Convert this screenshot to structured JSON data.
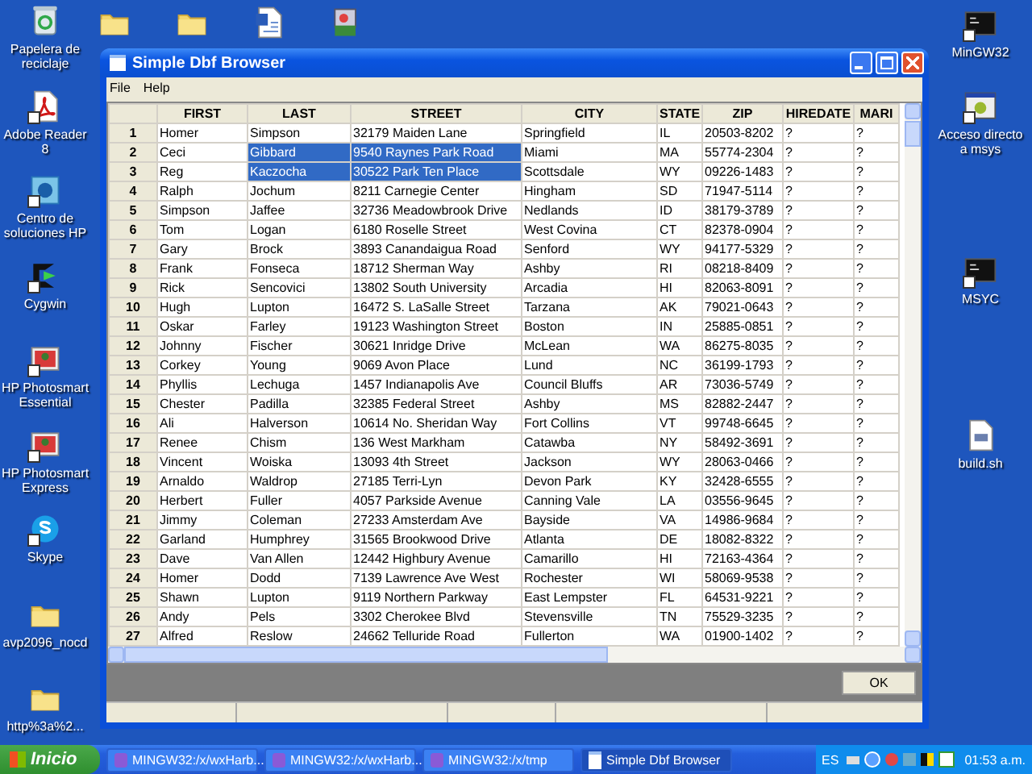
{
  "desktop": {
    "left_icons": [
      {
        "label": "Papelera de reciclaje",
        "kind": "recycle",
        "shortcut": false
      },
      {
        "label": "Adobe Reader 8",
        "kind": "pdf",
        "shortcut": true
      },
      {
        "label": "Centro de soluciones HP",
        "kind": "hp",
        "shortcut": true
      },
      {
        "label": "Cygwin",
        "kind": "cygwin",
        "shortcut": true
      },
      {
        "label": "HP Photosmart Essential",
        "kind": "photo",
        "shortcut": true
      },
      {
        "label": "HP Photosmart Express",
        "kind": "photo",
        "shortcut": true
      },
      {
        "label": "Skype",
        "kind": "skype",
        "shortcut": true
      },
      {
        "label": "avp2096_nocd",
        "kind": "folder",
        "shortcut": false
      },
      {
        "label": "http%3a%2...",
        "kind": "folder",
        "shortcut": false
      }
    ],
    "top_icons": [
      {
        "kind": "folder"
      },
      {
        "kind": "folder"
      },
      {
        "kind": "word"
      },
      {
        "kind": "installer"
      }
    ],
    "right_icons": [
      {
        "label": "MinGW32",
        "kind": "console",
        "shortcut": true
      },
      {
        "label": "Acceso directo a msys",
        "kind": "msys",
        "shortcut": true
      },
      {
        "label": "MSYC",
        "kind": "console",
        "shortcut": true
      },
      {
        "label": "build.sh",
        "kind": "file",
        "shortcut": false
      }
    ]
  },
  "window": {
    "title": "Simple Dbf Browser",
    "menu": [
      "File",
      "Help"
    ],
    "table": {
      "columns": [
        "FIRST",
        "LAST",
        "STREET",
        "CITY",
        "STATE",
        "ZIP",
        "HIREDATE",
        "MARI"
      ],
      "rows": [
        {
          "number": "1",
          "cells": [
            {
              "text": "Homer",
              "selected": false
            },
            {
              "text": "Simpson",
              "selected": false
            },
            {
              "text": "32179 Maiden Lane",
              "selected": false
            },
            {
              "text": "Springfield",
              "selected": false
            },
            {
              "text": "IL",
              "selected": false
            },
            {
              "text": "20503-8202",
              "selected": false
            },
            {
              "text": "?",
              "selected": false
            },
            {
              "text": "?",
              "selected": false
            }
          ]
        },
        {
          "number": "2",
          "cells": [
            {
              "text": "Ceci",
              "selected": false
            },
            {
              "text": "Gibbard",
              "selected": true
            },
            {
              "text": "9540 Raynes Park Road",
              "selected": true
            },
            {
              "text": "Miami",
              "selected": false
            },
            {
              "text": "MA",
              "selected": false
            },
            {
              "text": "55774-2304",
              "selected": false
            },
            {
              "text": "?",
              "selected": false
            },
            {
              "text": "?",
              "selected": false
            }
          ]
        },
        {
          "number": "3",
          "cells": [
            {
              "text": "Reg",
              "selected": false
            },
            {
              "text": "Kaczocha",
              "selected": true
            },
            {
              "text": "30522 Park Ten Place",
              "selected": true
            },
            {
              "text": "Scottsdale",
              "selected": false
            },
            {
              "text": "WY",
              "selected": false
            },
            {
              "text": "09226-1483",
              "selected": false
            },
            {
              "text": "?",
              "selected": false
            },
            {
              "text": "?",
              "selected": false
            }
          ]
        },
        {
          "number": "4",
          "cells": [
            {
              "text": "Ralph",
              "selected": false
            },
            {
              "text": "Jochum",
              "selected": false
            },
            {
              "text": "8211 Carnegie Center",
              "selected": false
            },
            {
              "text": "Hingham",
              "selected": false
            },
            {
              "text": "SD",
              "selected": false
            },
            {
              "text": "71947-5114",
              "selected": false
            },
            {
              "text": "?",
              "selected": false
            },
            {
              "text": "?",
              "selected": false
            }
          ]
        },
        {
          "number": "5",
          "cells": [
            {
              "text": "Simpson",
              "selected": false
            },
            {
              "text": "Jaffee",
              "selected": false
            },
            {
              "text": "32736 Meadowbrook Drive",
              "selected": false
            },
            {
              "text": "Nedlands",
              "selected": false
            },
            {
              "text": "ID",
              "selected": false
            },
            {
              "text": "38179-3789",
              "selected": false
            },
            {
              "text": "?",
              "selected": false
            },
            {
              "text": "?",
              "selected": false
            }
          ]
        },
        {
          "number": "6",
          "cells": [
            {
              "text": "Tom",
              "selected": false
            },
            {
              "text": "Logan",
              "selected": false
            },
            {
              "text": "6180 Roselle Street",
              "selected": false
            },
            {
              "text": "West Covina",
              "selected": false
            },
            {
              "text": "CT",
              "selected": false
            },
            {
              "text": "82378-0904",
              "selected": false
            },
            {
              "text": "?",
              "selected": false
            },
            {
              "text": "?",
              "selected": false
            }
          ]
        },
        {
          "number": "7",
          "cells": [
            {
              "text": "Gary",
              "selected": false
            },
            {
              "text": "Brock",
              "selected": false
            },
            {
              "text": "3893 Canandaigua Road",
              "selected": false
            },
            {
              "text": "Senford",
              "selected": false
            },
            {
              "text": "WY",
              "selected": false
            },
            {
              "text": "94177-5329",
              "selected": false
            },
            {
              "text": "?",
              "selected": false
            },
            {
              "text": "?",
              "selected": false
            }
          ]
        },
        {
          "number": "8",
          "cells": [
            {
              "text": "Frank",
              "selected": false
            },
            {
              "text": "Fonseca",
              "selected": false
            },
            {
              "text": "18712 Sherman Way",
              "selected": false
            },
            {
              "text": "Ashby",
              "selected": false
            },
            {
              "text": "RI",
              "selected": false
            },
            {
              "text": "08218-8409",
              "selected": false
            },
            {
              "text": "?",
              "selected": false
            },
            {
              "text": "?",
              "selected": false
            }
          ]
        },
        {
          "number": "9",
          "cells": [
            {
              "text": "Rick",
              "selected": false
            },
            {
              "text": "Sencovici",
              "selected": false
            },
            {
              "text": "13802 South University",
              "selected": false
            },
            {
              "text": "Arcadia",
              "selected": false
            },
            {
              "text": "HI",
              "selected": false
            },
            {
              "text": "82063-8091",
              "selected": false
            },
            {
              "text": "?",
              "selected": false
            },
            {
              "text": "?",
              "selected": false
            }
          ]
        },
        {
          "number": "10",
          "cells": [
            {
              "text": "Hugh",
              "selected": false
            },
            {
              "text": "Lupton",
              "selected": false
            },
            {
              "text": "16472 S. LaSalle Street",
              "selected": false
            },
            {
              "text": "Tarzana",
              "selected": false
            },
            {
              "text": "AK",
              "selected": false
            },
            {
              "text": "79021-0643",
              "selected": false
            },
            {
              "text": "?",
              "selected": false
            },
            {
              "text": "?",
              "selected": false
            }
          ]
        },
        {
          "number": "11",
          "cells": [
            {
              "text": "Oskar",
              "selected": false
            },
            {
              "text": "Farley",
              "selected": false
            },
            {
              "text": "19123 Washington Street",
              "selected": false
            },
            {
              "text": "Boston",
              "selected": false
            },
            {
              "text": "IN",
              "selected": false
            },
            {
              "text": "25885-0851",
              "selected": false
            },
            {
              "text": "?",
              "selected": false
            },
            {
              "text": "?",
              "selected": false
            }
          ]
        },
        {
          "number": "12",
          "cells": [
            {
              "text": "Johnny",
              "selected": false
            },
            {
              "text": "Fischer",
              "selected": false
            },
            {
              "text": "30621 Inridge Drive",
              "selected": false
            },
            {
              "text": "McLean",
              "selected": false
            },
            {
              "text": "WA",
              "selected": false
            },
            {
              "text": "86275-8035",
              "selected": false
            },
            {
              "text": "?",
              "selected": false
            },
            {
              "text": "?",
              "selected": false
            }
          ]
        },
        {
          "number": "13",
          "cells": [
            {
              "text": "Corkey",
              "selected": false
            },
            {
              "text": "Young",
              "selected": false
            },
            {
              "text": "9069 Avon Place",
              "selected": false
            },
            {
              "text": "Lund",
              "selected": false
            },
            {
              "text": "NC",
              "selected": false
            },
            {
              "text": "36199-1793",
              "selected": false
            },
            {
              "text": "?",
              "selected": false
            },
            {
              "text": "?",
              "selected": false
            }
          ]
        },
        {
          "number": "14",
          "cells": [
            {
              "text": "Phyllis",
              "selected": false
            },
            {
              "text": "Lechuga",
              "selected": false
            },
            {
              "text": "1457 Indianapolis Ave",
              "selected": false
            },
            {
              "text": "Council Bluffs",
              "selected": false
            },
            {
              "text": "AR",
              "selected": false
            },
            {
              "text": "73036-5749",
              "selected": false
            },
            {
              "text": "?",
              "selected": false
            },
            {
              "text": "?",
              "selected": false
            }
          ]
        },
        {
          "number": "15",
          "cells": [
            {
              "text": "Chester",
              "selected": false
            },
            {
              "text": "Padilla",
              "selected": false
            },
            {
              "text": "32385 Federal Street",
              "selected": false
            },
            {
              "text": "Ashby",
              "selected": false
            },
            {
              "text": "MS",
              "selected": false
            },
            {
              "text": "82882-2447",
              "selected": false
            },
            {
              "text": "?",
              "selected": false
            },
            {
              "text": "?",
              "selected": false
            }
          ]
        },
        {
          "number": "16",
          "cells": [
            {
              "text": "Ali",
              "selected": false
            },
            {
              "text": "Halverson",
              "selected": false
            },
            {
              "text": "10614 No. Sheridan Way",
              "selected": false
            },
            {
              "text": "Fort Collins",
              "selected": false
            },
            {
              "text": "VT",
              "selected": false
            },
            {
              "text": "99748-6645",
              "selected": false
            },
            {
              "text": "?",
              "selected": false
            },
            {
              "text": "?",
              "selected": false
            }
          ]
        },
        {
          "number": "17",
          "cells": [
            {
              "text": "Renee",
              "selected": false
            },
            {
              "text": "Chism",
              "selected": false
            },
            {
              "text": "136 West Markham",
              "selected": false
            },
            {
              "text": "Catawba",
              "selected": false
            },
            {
              "text": "NY",
              "selected": false
            },
            {
              "text": "58492-3691",
              "selected": false
            },
            {
              "text": "?",
              "selected": false
            },
            {
              "text": "?",
              "selected": false
            }
          ]
        },
        {
          "number": "18",
          "cells": [
            {
              "text": "Vincent",
              "selected": false
            },
            {
              "text": "Woiska",
              "selected": false
            },
            {
              "text": "13093 4th Street",
              "selected": false
            },
            {
              "text": "Jackson",
              "selected": false
            },
            {
              "text": "WY",
              "selected": false
            },
            {
              "text": "28063-0466",
              "selected": false
            },
            {
              "text": "?",
              "selected": false
            },
            {
              "text": "?",
              "selected": false
            }
          ]
        },
        {
          "number": "19",
          "cells": [
            {
              "text": "Arnaldo",
              "selected": false
            },
            {
              "text": "Waldrop",
              "selected": false
            },
            {
              "text": "27185 Terri-Lyn",
              "selected": false
            },
            {
              "text": "Devon Park",
              "selected": false
            },
            {
              "text": "KY",
              "selected": false
            },
            {
              "text": "32428-6555",
              "selected": false
            },
            {
              "text": "?",
              "selected": false
            },
            {
              "text": "?",
              "selected": false
            }
          ]
        },
        {
          "number": "20",
          "cells": [
            {
              "text": "Herbert",
              "selected": false
            },
            {
              "text": "Fuller",
              "selected": false
            },
            {
              "text": "4057 Parkside Avenue",
              "selected": false
            },
            {
              "text": "Canning Vale",
              "selected": false
            },
            {
              "text": "LA",
              "selected": false
            },
            {
              "text": "03556-9645",
              "selected": false
            },
            {
              "text": "?",
              "selected": false
            },
            {
              "text": "?",
              "selected": false
            }
          ]
        },
        {
          "number": "21",
          "cells": [
            {
              "text": "Jimmy",
              "selected": false
            },
            {
              "text": "Coleman",
              "selected": false
            },
            {
              "text": "27233 Amsterdam Ave",
              "selected": false
            },
            {
              "text": "Bayside",
              "selected": false
            },
            {
              "text": "VA",
              "selected": false
            },
            {
              "text": "14986-9684",
              "selected": false
            },
            {
              "text": "?",
              "selected": false
            },
            {
              "text": "?",
              "selected": false
            }
          ]
        },
        {
          "number": "22",
          "cells": [
            {
              "text": "Garland",
              "selected": false
            },
            {
              "text": "Humphrey",
              "selected": false
            },
            {
              "text": "31565 Brookwood Drive",
              "selected": false
            },
            {
              "text": "Atlanta",
              "selected": false
            },
            {
              "text": "DE",
              "selected": false
            },
            {
              "text": "18082-8322",
              "selected": false
            },
            {
              "text": "?",
              "selected": false
            },
            {
              "text": "?",
              "selected": false
            }
          ]
        },
        {
          "number": "23",
          "cells": [
            {
              "text": "Dave",
              "selected": false
            },
            {
              "text": "Van Allen",
              "selected": false
            },
            {
              "text": "12442 Highbury Avenue",
              "selected": false
            },
            {
              "text": "Camarillo",
              "selected": false
            },
            {
              "text": "HI",
              "selected": false
            },
            {
              "text": "72163-4364",
              "selected": false
            },
            {
              "text": "?",
              "selected": false
            },
            {
              "text": "?",
              "selected": false
            }
          ]
        },
        {
          "number": "24",
          "cells": [
            {
              "text": "Homer",
              "selected": false
            },
            {
              "text": "Dodd",
              "selected": false
            },
            {
              "text": "7139 Lawrence Ave West",
              "selected": false
            },
            {
              "text": "Rochester",
              "selected": false
            },
            {
              "text": "WI",
              "selected": false
            },
            {
              "text": "58069-9538",
              "selected": false
            },
            {
              "text": "?",
              "selected": false
            },
            {
              "text": "?",
              "selected": false
            }
          ]
        },
        {
          "number": "25",
          "cells": [
            {
              "text": "Shawn",
              "selected": false
            },
            {
              "text": "Lupton",
              "selected": false
            },
            {
              "text": "9119 Northern Parkway",
              "selected": false
            },
            {
              "text": "East Lempster",
              "selected": false
            },
            {
              "text": "FL",
              "selected": false
            },
            {
              "text": "64531-9221",
              "selected": false
            },
            {
              "text": "?",
              "selected": false
            },
            {
              "text": "?",
              "selected": false
            }
          ]
        },
        {
          "number": "26",
          "cells": [
            {
              "text": "Andy",
              "selected": false
            },
            {
              "text": "Pels",
              "selected": false
            },
            {
              "text": "3302 Cherokee Blvd",
              "selected": false
            },
            {
              "text": "Stevensville",
              "selected": false
            },
            {
              "text": "TN",
              "selected": false
            },
            {
              "text": "75529-3235",
              "selected": false
            },
            {
              "text": "?",
              "selected": false
            },
            {
              "text": "?",
              "selected": false
            }
          ]
        },
        {
          "number": "27",
          "cells": [
            {
              "text": "Alfred",
              "selected": false
            },
            {
              "text": "Reslow",
              "selected": false
            },
            {
              "text": "24662 Telluride Road",
              "selected": false
            },
            {
              "text": "Fullerton",
              "selected": false
            },
            {
              "text": "WA",
              "selected": false
            },
            {
              "text": "01900-1402",
              "selected": false
            },
            {
              "text": "?",
              "selected": false
            },
            {
              "text": "?",
              "selected": false
            }
          ]
        }
      ]
    },
    "buttons": [
      "OK"
    ]
  },
  "taskbar": {
    "start": "Inicio",
    "tasks": [
      {
        "label": "MINGW32:/x/wxHarb...",
        "kind": "mingw",
        "selected": false
      },
      {
        "label": "MINGW32:/x/wxHarb...",
        "kind": "mingw",
        "selected": false
      },
      {
        "label": "MINGW32:/x/tmp",
        "kind": "mingw",
        "selected": false
      },
      {
        "label": "Simple Dbf Browser",
        "kind": "window",
        "selected": true
      }
    ],
    "language": "ES",
    "clock": "01:53 a.m."
  }
}
